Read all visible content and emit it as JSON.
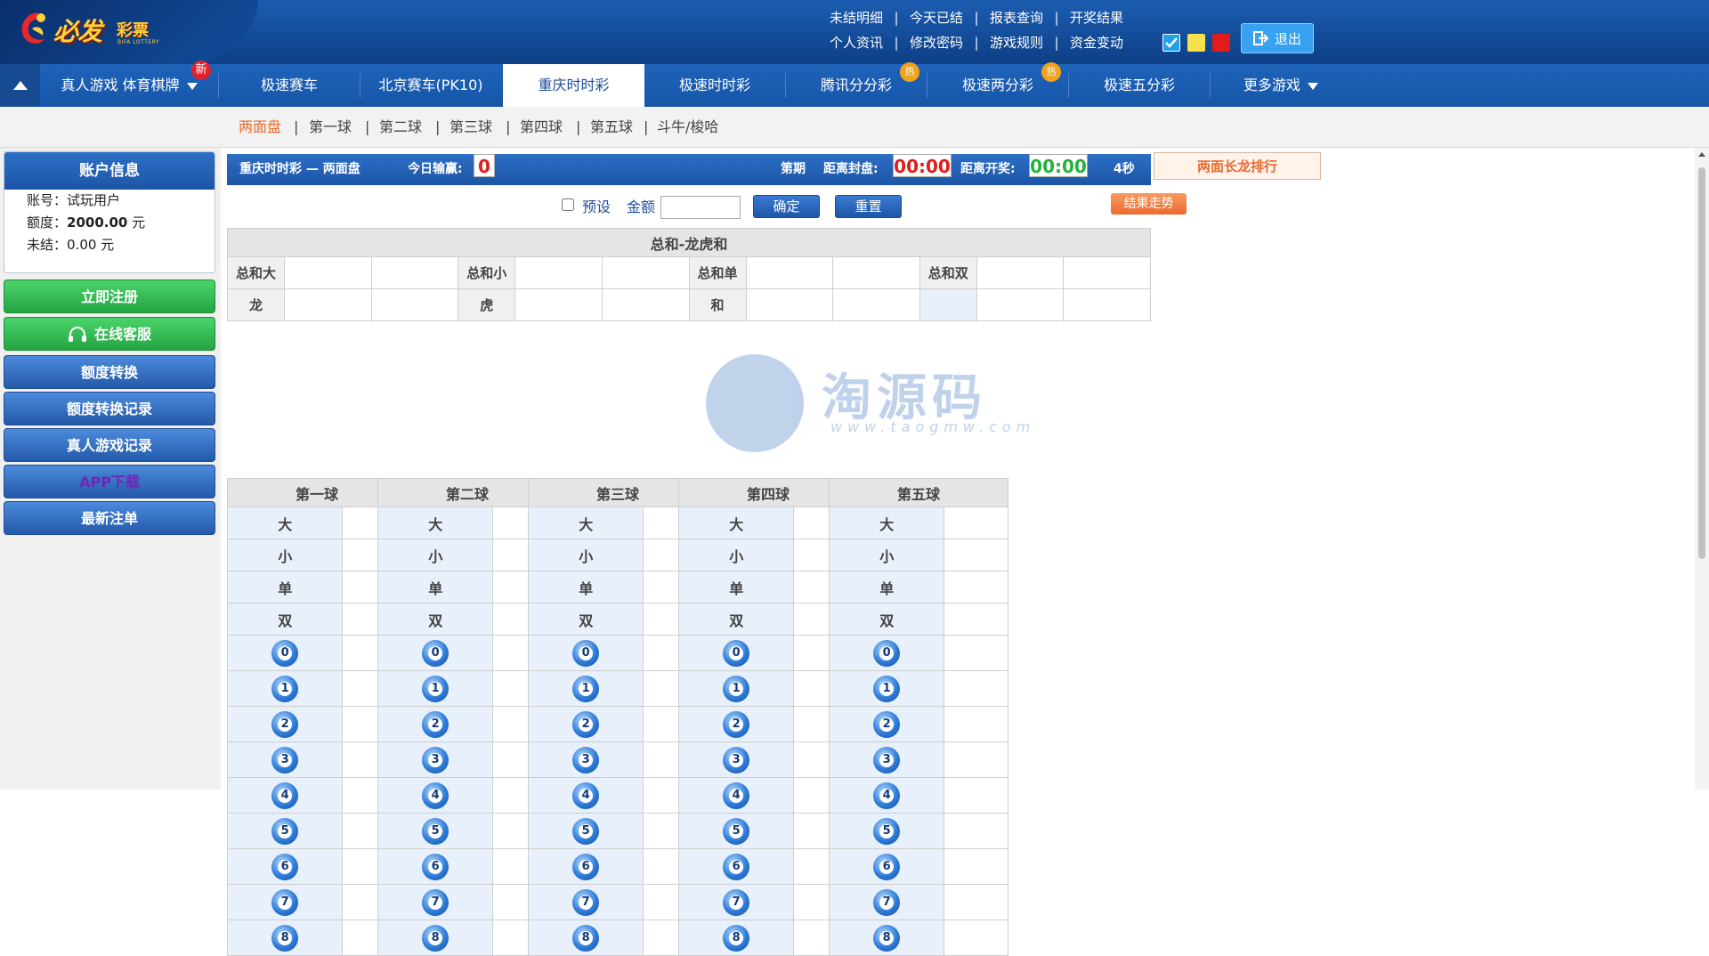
{
  "logo": {
    "text": "必发",
    "text2": "彩票",
    "sub": "BIFA LOTTERY"
  },
  "header": {
    "row1": [
      "未结明细",
      "今天已结",
      "报表查询",
      "开奖结果"
    ],
    "row2": [
      "个人资讯",
      "修改密码",
      "游戏规则",
      "资金变动"
    ],
    "logout": "退出",
    "themes": [
      "#1fa0e8",
      "#f6e04b",
      "#e21c1c"
    ]
  },
  "nav": {
    "items": [
      "真人游戏 体育棋牌",
      "极速赛车",
      "北京赛车(PK10)",
      "重庆时时彩",
      "极速时时彩",
      "腾讯分分彩",
      "极速两分彩",
      "极速五分彩",
      "更多游戏"
    ],
    "badge_new": "新",
    "badge_hot": "热"
  },
  "subnav": {
    "items": [
      "两面盘",
      "第一球",
      "第二球",
      "第三球",
      "第四球",
      "第五球",
      "斗牛/梭哈"
    ]
  },
  "account": {
    "title": "账户信息",
    "acct_label": "账号：",
    "acct_value": "试玩用户",
    "quota_label": "额度：",
    "quota_value": "2000.00",
    "quota_unit": " 元",
    "unsettled_label": "未结：",
    "unsettled_value": "0.00 元"
  },
  "side_buttons": [
    "立即注册",
    "在线客服",
    "额度转换",
    "额度转换记录",
    "真人游戏记录",
    "APP下载",
    "最新注单"
  ],
  "game": {
    "title": "重庆时时彩 — 两面盘",
    "today_label": "今日输赢:",
    "today_value": "0",
    "period_label": "第期",
    "close_label": "距离封盘:",
    "close_value": "00:00",
    "open_label": "距离开奖:",
    "open_value": "00:00",
    "seconds": "4秒",
    "rank": "两面长龙排行"
  },
  "controls": {
    "preset": "预设",
    "amount": "金额",
    "confirm": "确定",
    "reset": "重置",
    "trend": "结果走势"
  },
  "sum_table": {
    "title": "总和-龙虎和",
    "row1": [
      "总和大",
      "总和小",
      "总和单",
      "总和双"
    ],
    "row2": [
      "龙",
      "虎",
      "和",
      ""
    ]
  },
  "balls": {
    "titles": [
      "第一球",
      "第二球",
      "第三球",
      "第四球",
      "第五球"
    ],
    "options": [
      "大",
      "小",
      "单",
      "双"
    ],
    "numbers": [
      "0",
      "1",
      "2",
      "3",
      "4",
      "5",
      "6",
      "7",
      "8"
    ]
  },
  "watermark": {
    "text": "淘源码",
    "url": "www.taogmw.com"
  }
}
